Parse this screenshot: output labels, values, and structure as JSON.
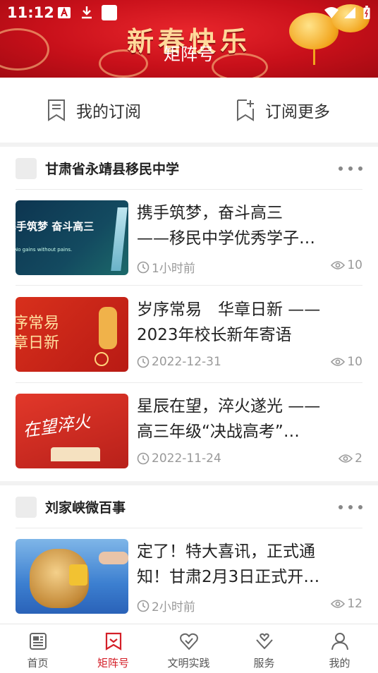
{
  "status_bar": {
    "time": "11:12"
  },
  "header": {
    "banner_text": "新春快乐",
    "title": "矩阵号"
  },
  "subscribe": {
    "my_label": "我的订阅",
    "more_label": "订阅更多"
  },
  "cards": [
    {
      "name": "甘肃省永靖县移民中学",
      "items": [
        {
          "title_line1": "携手筑梦，奋斗高三",
          "title_line2": "——移民中学优秀学子…",
          "time": "1小时前",
          "views": "10",
          "thumb_text": "携手筑梦 奋斗高三",
          "thumb_sub": "No gains without pains."
        },
        {
          "title_line1": "岁序常易　华章日新 ——",
          "title_line2": "2023年校长新年寄语",
          "time": "2022-12-31",
          "views": "10",
          "thumb_text1": "序常易",
          "thumb_text2": "章日新"
        },
        {
          "title_line1": "星辰在望，淬火遂光 ——",
          "title_line2": "高三年级“决战高考”…",
          "time": "2022-11-24",
          "views": "2",
          "thumb_text": "在望淬火"
        }
      ]
    },
    {
      "name": "刘家峡微百事",
      "items": [
        {
          "title_line1": "定了！特大喜讯，正式通",
          "title_line2": "知！甘肃2月3日正式开…",
          "time": "2小时前",
          "views": "12"
        }
      ]
    }
  ],
  "tabs": [
    {
      "label": "首页"
    },
    {
      "label": "矩阵号"
    },
    {
      "label": "文明实践"
    },
    {
      "label": "服务"
    },
    {
      "label": "我的"
    }
  ],
  "colors": {
    "accent": "#d41f28",
    "banner": "#c8101a"
  }
}
